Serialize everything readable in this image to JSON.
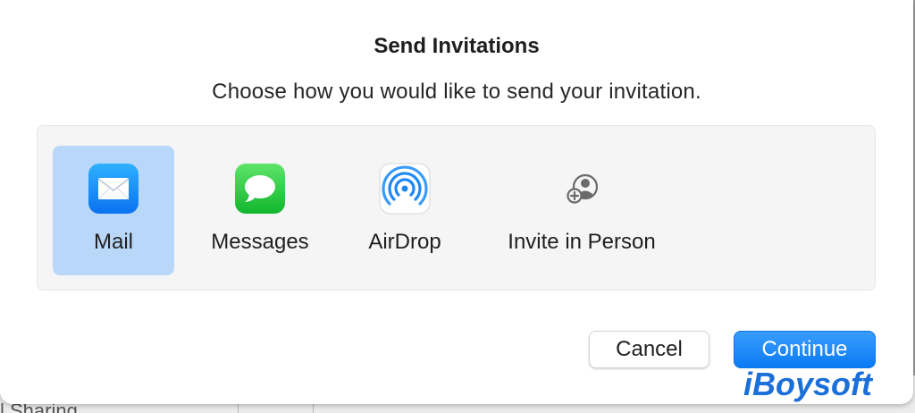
{
  "dialog": {
    "title": "Send Invitations",
    "subtitle": "Choose how you would like to send your invitation."
  },
  "options": [
    {
      "label": "Mail",
      "icon": "mail-icon",
      "selected": true
    },
    {
      "label": "Messages",
      "icon": "messages-icon",
      "selected": false
    },
    {
      "label": "AirDrop",
      "icon": "airdrop-icon",
      "selected": false
    },
    {
      "label": "Invite in Person",
      "icon": "invite-in-person-icon",
      "selected": false
    }
  ],
  "buttons": {
    "cancel": "Cancel",
    "continue": "Continue"
  },
  "background": {
    "partial_text": "l Sharing"
  },
  "watermark": {
    "text": "iBoysoft"
  },
  "colors": {
    "accent": "#0a7bf5",
    "selection": "#b9d7f8",
    "panel": "#f5f5f5"
  }
}
